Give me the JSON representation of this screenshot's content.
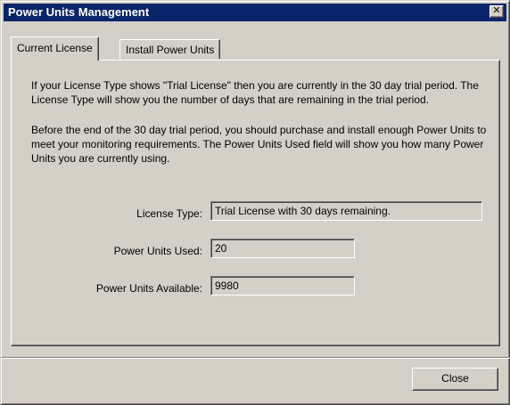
{
  "window": {
    "title": "Power Units Management",
    "close_glyph": "✕"
  },
  "tabs": [
    {
      "label": "Current License",
      "active": true
    },
    {
      "label": "Install Power Units",
      "active": false
    }
  ],
  "panel": {
    "paragraph_1": "If your License Type shows \"Trial License\" then you are currently in the 30 day trial period. The License Type will show you the number of days that are remaining in the trial period.",
    "paragraph_2": "Before the end of the 30 day trial period, you should purchase and install enough Power Units to meet your monitoring requirements. The Power Units Used field will show you how many Power Units you are currently using.",
    "fields": [
      {
        "label": "License Type:",
        "value": "Trial License with 30 days remaining."
      },
      {
        "label": "Power Units Used:",
        "value": "20"
      },
      {
        "label": "Power Units Available:",
        "value": "9980"
      }
    ]
  },
  "footer": {
    "close_label": "Close"
  }
}
